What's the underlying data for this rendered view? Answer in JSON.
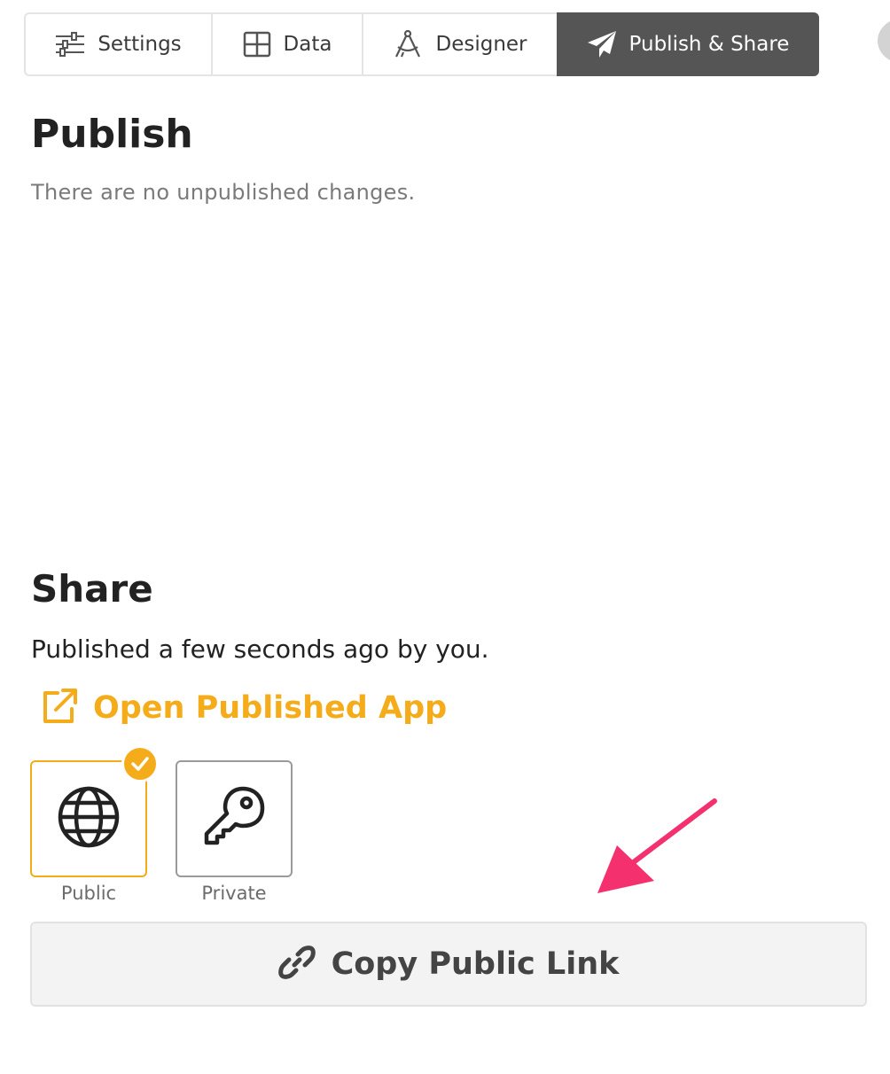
{
  "tabs": [
    {
      "label": "Settings",
      "icon": "sliders-icon",
      "active": false
    },
    {
      "label": "Data",
      "icon": "grid-icon",
      "active": false
    },
    {
      "label": "Designer",
      "icon": "compass-icon",
      "active": false
    },
    {
      "label": "Publish & Share",
      "icon": "paper-plane-icon",
      "active": true
    }
  ],
  "publish": {
    "title": "Publish",
    "status": "There are no unpublished changes."
  },
  "share": {
    "title": "Share",
    "published_by": "Published a few seconds ago by you.",
    "open_app_label": "Open Published App",
    "visibility": [
      {
        "label": "Public",
        "icon": "globe-icon",
        "selected": true
      },
      {
        "label": "Private",
        "icon": "key-icon",
        "selected": false
      }
    ],
    "copy_link_label": "Copy Public Link"
  },
  "colors": {
    "accent": "#f4ac1b",
    "active_tab": "#555555",
    "annotation_arrow": "#f5306e"
  }
}
